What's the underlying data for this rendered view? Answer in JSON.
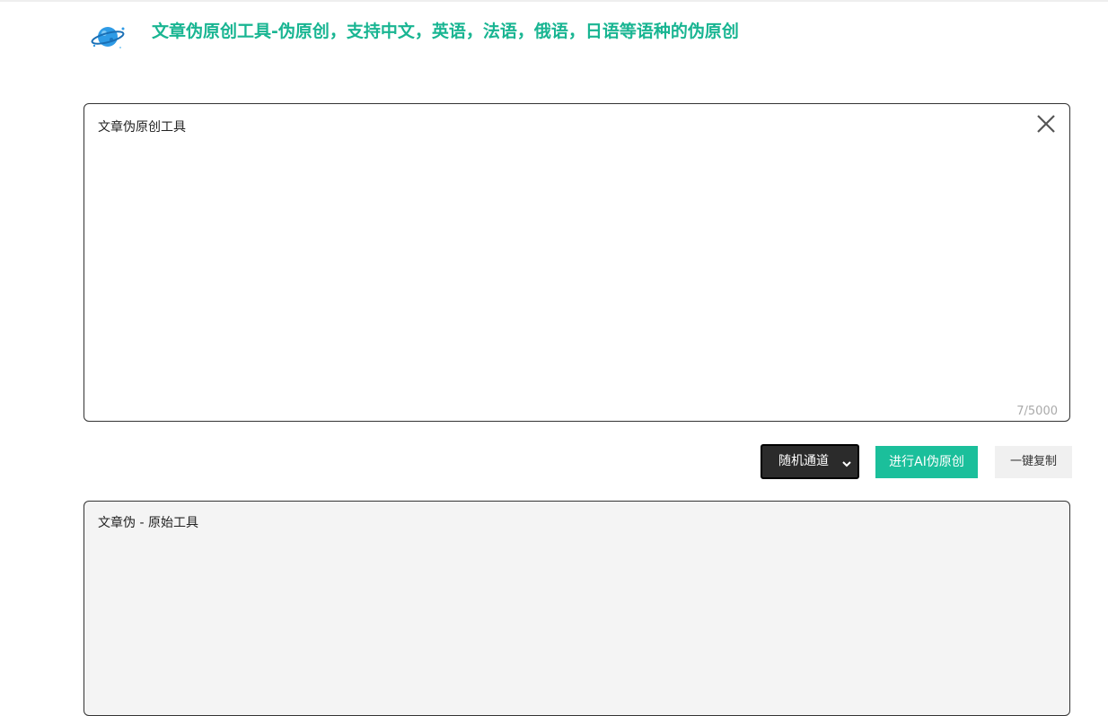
{
  "header": {
    "logo_icon": "planet-logo-icon",
    "title": "文章伪原创工具-伪原创，支持中文，英语，法语，俄语，日语等语种的伪原创",
    "title_color": "#19b592"
  },
  "input": {
    "text": "文章伪原创工具",
    "counter": "7/5000",
    "clear_icon": "close-icon"
  },
  "controls": {
    "channel_select": {
      "selected": "随机通道",
      "icon": "chevron-down-icon"
    },
    "rewrite_label": "进行AI伪原创",
    "copy_label": "一键复制",
    "accent_color": "#1bbf9b"
  },
  "output": {
    "text": "文章伪 - 原始工具"
  }
}
